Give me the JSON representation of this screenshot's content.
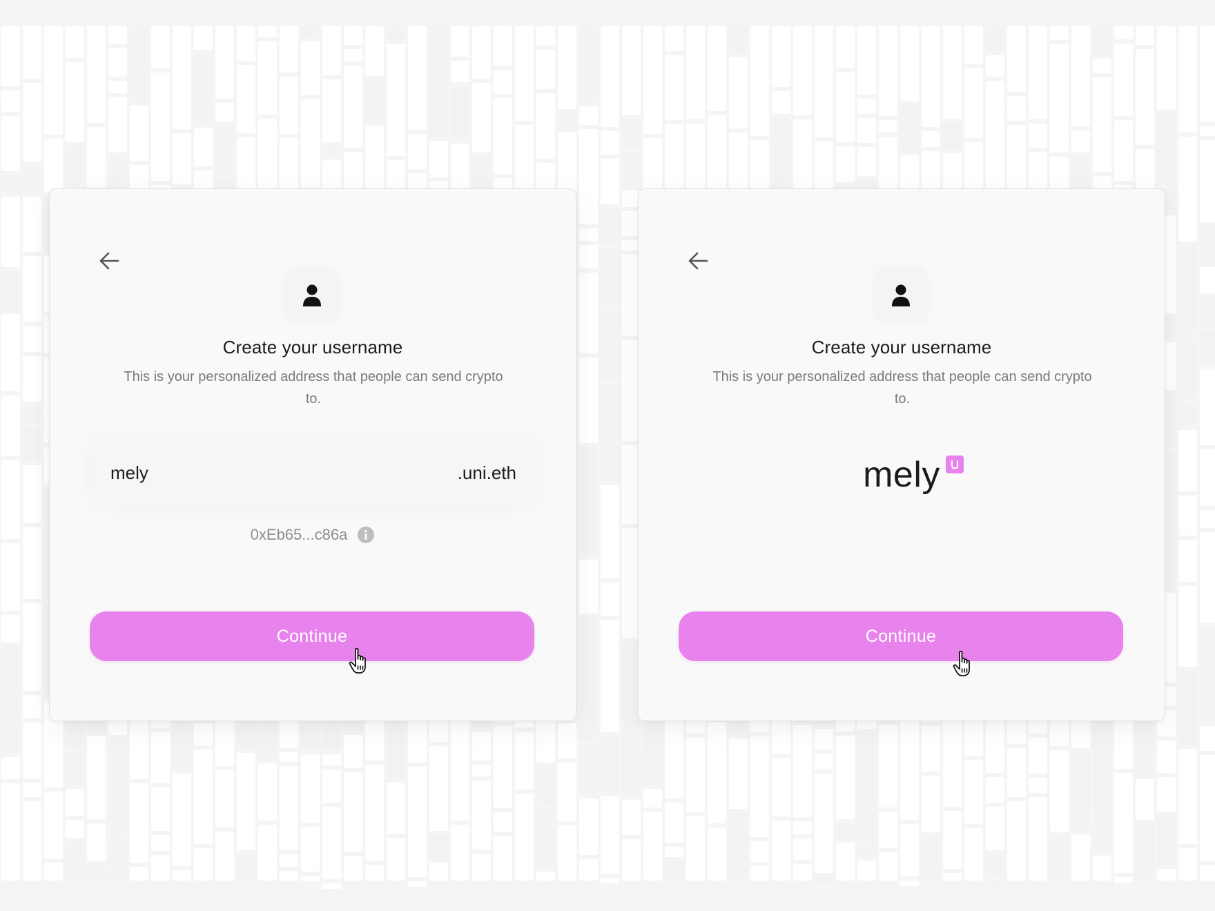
{
  "accent_color": "#e882ec",
  "screens": {
    "left": {
      "back_icon": "arrow-left-icon",
      "avatar_icon": "user-icon",
      "title": "Create your username",
      "subtitle": "This is your personalized address that people can send crypto to.",
      "username_value": "mely",
      "username_suffix": ".uni.eth",
      "wallet_address": "0xEb65...c86a",
      "info_icon": "info-icon",
      "continue_label": "Continue",
      "cursor_icon": "hand-pointer-icon"
    },
    "right": {
      "back_icon": "arrow-left-icon",
      "avatar_icon": "user-icon",
      "title": "Create your username",
      "subtitle": "This is your personalized address that people can send crypto to.",
      "display_name": "mely",
      "badge_icon": "uniswap-badge-icon",
      "continue_label": "Continue",
      "cursor_icon": "hand-pointer-icon"
    }
  }
}
